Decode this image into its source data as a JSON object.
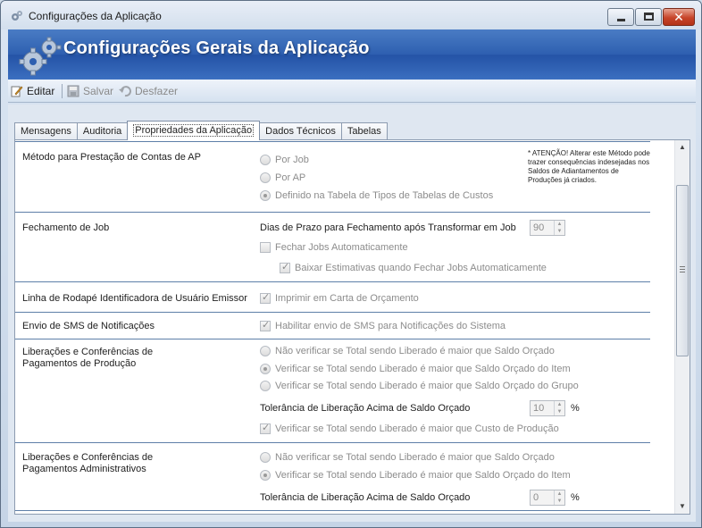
{
  "window": {
    "title": "Configurações da Aplicação",
    "banner_title": "Configurações Gerais da Aplicação",
    "close_glyph": "✕"
  },
  "toolbar": {
    "edit_label": "Editar",
    "save_label": "Salvar",
    "undo_label": "Desfazer"
  },
  "tabs": [
    {
      "label": "Mensagens",
      "active": false
    },
    {
      "label": "Auditoria",
      "active": false
    },
    {
      "label": "Propriedades da Aplicação",
      "active": true
    },
    {
      "label": "Dados Técnicos",
      "active": false
    },
    {
      "label": "Tabelas",
      "active": false
    }
  ],
  "sections": {
    "prestacao": {
      "label": "Método para Prestação de Contas de AP",
      "options": [
        "Por Job",
        "Por AP",
        "Definido na Tabela de Tipos de Tabelas de Custos"
      ],
      "selected": 2,
      "warning": "* ATENÇÃO! Alterar este Método pode trazer consequências indesejadas nos Saldos de Adiantamentos de Produções já criados."
    },
    "fechamento": {
      "label": "Fechamento de Job",
      "prazo_label": "Dias de Prazo para Fechamento após Transformar em Job",
      "prazo_value": "90",
      "auto_label": "Fechar Jobs Automaticamente",
      "auto_checked": false,
      "baixar_label": "Baixar Estimativas quando Fechar Jobs Automaticamente",
      "baixar_checked": true
    },
    "rodape": {
      "label": "Linha de Rodapé Identificadora de Usuário Emissor",
      "option_label": "Imprimir em Carta de Orçamento",
      "checked": true
    },
    "sms": {
      "label": "Envio de SMS de Notificações",
      "option_label": "Habilitar envio de SMS para Notificações do Sistema",
      "checked": true
    },
    "producao": {
      "label_line1": "Liberações e Conferências de",
      "label_line2": "Pagamentos de Produção",
      "options": [
        "Não verificar se Total sendo Liberado é maior que Saldo Orçado",
        "Verificar se Total sendo Liberado é maior que Saldo Orçado do Item",
        "Verificar se Total sendo Liberado é maior que Saldo Orçado do Grupo"
      ],
      "selected": 1,
      "tolerancia_label": "Tolerância de Liberação Acima de Saldo Orçado",
      "tolerancia_value": "10",
      "pct": "%",
      "custo_label": "Verificar se Total sendo Liberado é maior que Custo de Produção",
      "custo_checked": true
    },
    "administrativos": {
      "label_line1": "Liberações e Conferências de",
      "label_line2": "Pagamentos Administrativos",
      "options": [
        "Não verificar se Total sendo Liberado é maior que Saldo Orçado",
        "Verificar se Total sendo Liberado é maior que Saldo Orçado do Item"
      ],
      "selected": 1,
      "tolerancia_label": "Tolerância de Liberação Acima de Saldo Orçado",
      "tolerancia_value": "0",
      "pct": "%"
    }
  },
  "colors": {
    "banner": "#2e5fb0",
    "separator": "#5e7fa8"
  }
}
